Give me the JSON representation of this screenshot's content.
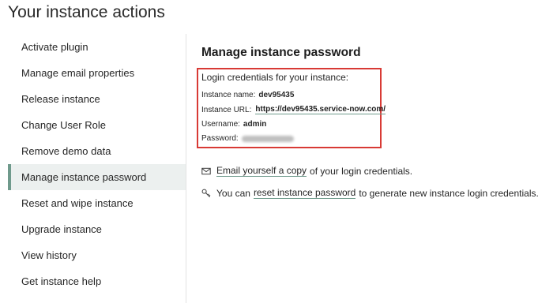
{
  "page": {
    "title": "Your instance actions"
  },
  "sidebar": {
    "items": [
      {
        "label": "Activate plugin"
      },
      {
        "label": "Manage email properties"
      },
      {
        "label": "Release instance"
      },
      {
        "label": "Change User Role"
      },
      {
        "label": "Remove demo data"
      },
      {
        "label": "Manage instance password",
        "active": true
      },
      {
        "label": "Reset and wipe instance"
      },
      {
        "label": "Upgrade instance"
      },
      {
        "label": "View history"
      },
      {
        "label": "Get instance help"
      }
    ],
    "active_color": "#6f9a8c"
  },
  "main": {
    "heading": "Manage instance password",
    "credentials": {
      "intro": "Login credentials for your instance:",
      "name_label": "Instance name:",
      "name_value": "dev95435",
      "url_label": "Instance URL:",
      "url_value": "https://dev95435.service-now.com/",
      "username_label": "Username:",
      "username_value": "admin",
      "password_label": "Password:",
      "highlight_color": "#d83a35"
    },
    "email_action": {
      "icon": "envelope-icon",
      "link": "Email yourself a copy",
      "rest": "of your login credentials."
    },
    "reset_action": {
      "icon": "key-icon",
      "prefix": "You can",
      "link": "reset instance password",
      "rest": "to generate new instance login credentials."
    }
  }
}
